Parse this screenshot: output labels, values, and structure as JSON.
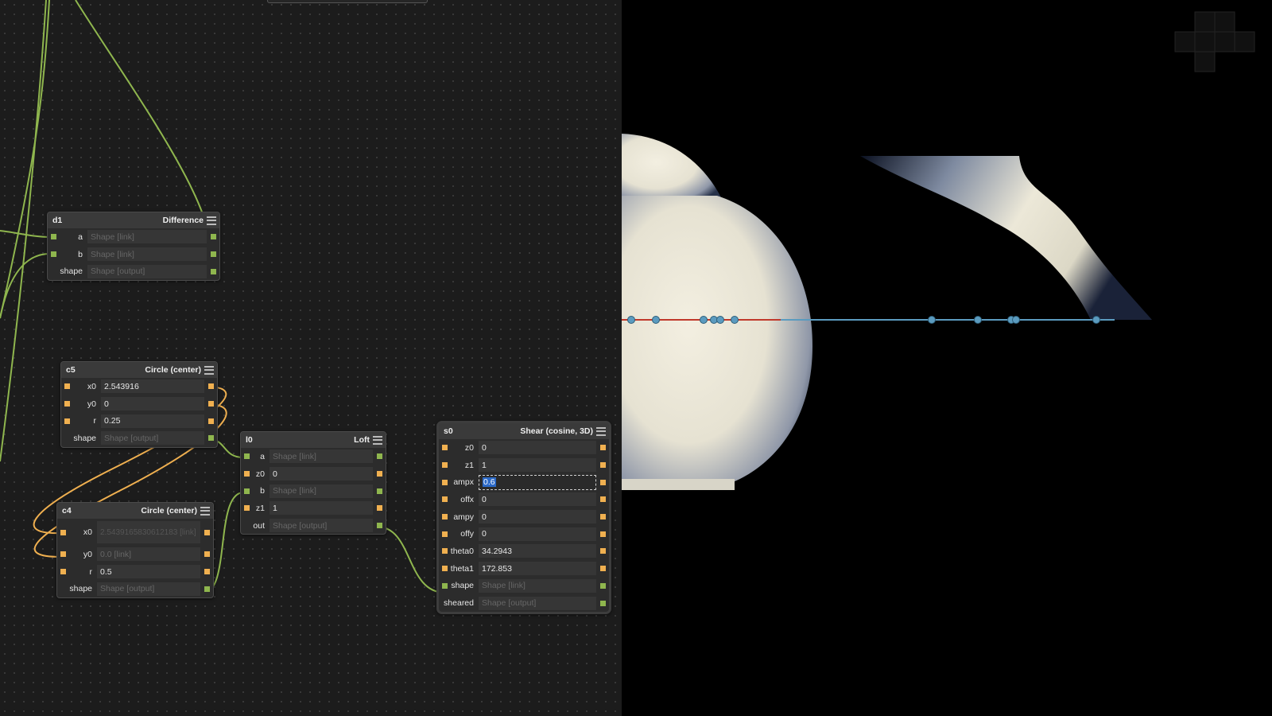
{
  "nodes": {
    "d1": {
      "id": "d1",
      "title": "Difference",
      "rows": [
        {
          "label": "a",
          "value": "Shape [link]"
        },
        {
          "label": "b",
          "value": "Shape [link]"
        },
        {
          "label": "shape",
          "value": "Shape [output]"
        }
      ]
    },
    "c5": {
      "id": "c5",
      "title": "Circle (center)",
      "rows": [
        {
          "label": "x0",
          "value": "2.543916"
        },
        {
          "label": "y0",
          "value": "0"
        },
        {
          "label": "r",
          "value": "0.25"
        },
        {
          "label": "shape",
          "value": "Shape [output]"
        }
      ]
    },
    "c4": {
      "id": "c4",
      "title": "Circle (center)",
      "rows": [
        {
          "label": "x0",
          "value": "2.5439165830612183 [link]"
        },
        {
          "label": "y0",
          "value": "0.0 [link]"
        },
        {
          "label": "r",
          "value": "0.5"
        },
        {
          "label": "shape",
          "value": "Shape [output]"
        }
      ]
    },
    "l0": {
      "id": "l0",
      "title": "Loft",
      "rows": [
        {
          "label": "a",
          "value": "Shape [link]"
        },
        {
          "label": "z0",
          "value": "0"
        },
        {
          "label": "b",
          "value": "Shape [link]"
        },
        {
          "label": "z1",
          "value": "1"
        },
        {
          "label": "out",
          "value": "Shape [output]"
        }
      ]
    },
    "s0": {
      "id": "s0",
      "title": "Shear (cosine, 3D)",
      "rows": [
        {
          "label": "z0",
          "value": "0"
        },
        {
          "label": "z1",
          "value": "1"
        },
        {
          "label": "ampx",
          "value": "0.6"
        },
        {
          "label": "offx",
          "value": "0"
        },
        {
          "label": "ampy",
          "value": "0"
        },
        {
          "label": "offy",
          "value": "0"
        },
        {
          "label": "theta0",
          "value": "34.2943"
        },
        {
          "label": "theta1",
          "value": "172.853"
        },
        {
          "label": "shape",
          "value": "Shape [link]"
        },
        {
          "label": "sheared",
          "value": "Shape [output]"
        }
      ]
    }
  },
  "colors": {
    "wire_shape": "#8fb64e",
    "wire_number": "#f0b050",
    "axis_red": "#c0392b",
    "axis_blue": "#5b9bbf",
    "surface": "#ece8d8"
  }
}
